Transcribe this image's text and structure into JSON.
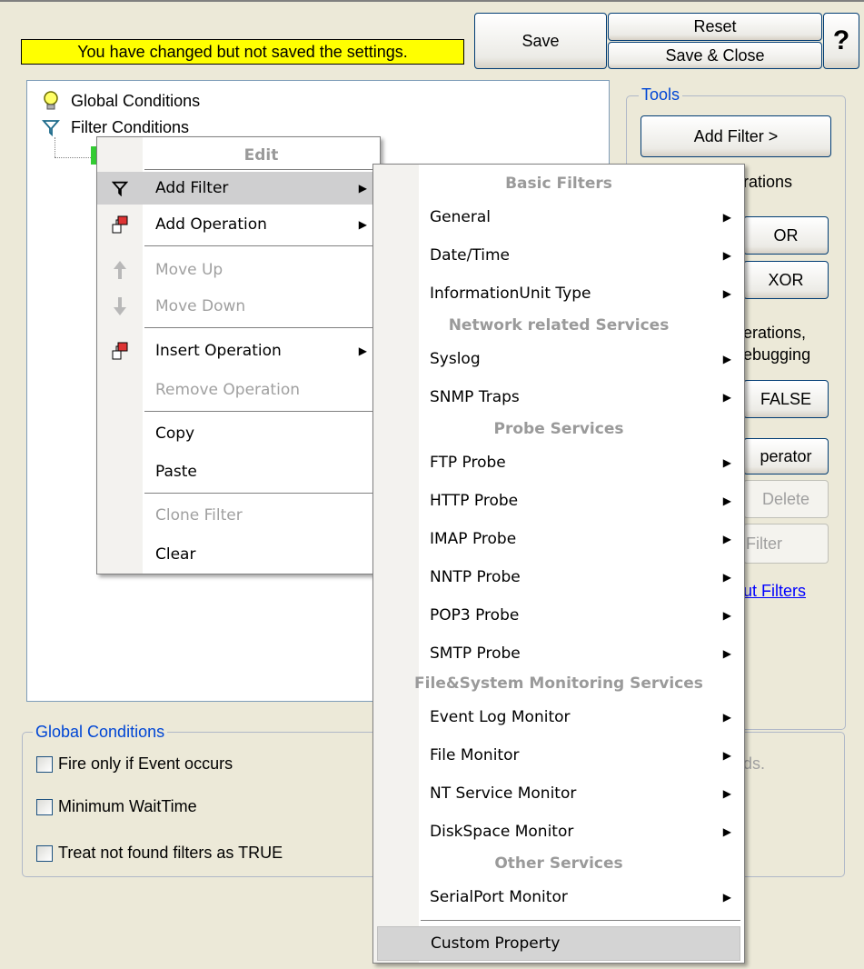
{
  "warning": "You have changed but not saved the settings.",
  "buttons": {
    "save": "Save",
    "reset": "Reset",
    "save_close": "Save & Close",
    "help": "?"
  },
  "tree": {
    "global_conditions": "Global Conditions",
    "filter_conditions": "Filter Conditions"
  },
  "tools": {
    "label": "Tools",
    "add_filter": "Add Filter >",
    "operations_text": "rations",
    "or": "OR",
    "xor": "XOR",
    "operations_text2": "erations,",
    "debugging_text": "ebugging",
    "false": "FALSE",
    "operator": "perator",
    "delete": "Delete",
    "filter": "Filter",
    "filters_link": "ut Filters",
    "seconds_text": "ds."
  },
  "global_conditions": {
    "label": "Global Conditions",
    "fire_only": "Fire only if Event occurs",
    "min_wait": "Minimum WaitTime",
    "treat_not_found": "Treat not found filters as TRUE"
  },
  "edit_menu": {
    "header": "Edit",
    "items": [
      {
        "label": "Add Filter",
        "icon": "filter-icon"
      },
      {
        "label": "Add Operation",
        "icon": "operation-icon"
      },
      {
        "label": "Move Up",
        "icon": "up-arrow-icon"
      },
      {
        "label": "Move Down",
        "icon": "down-arrow-icon"
      },
      {
        "label": "Insert Operation",
        "icon": "operation-icon"
      },
      {
        "label": "Remove Operation"
      },
      {
        "label": "Copy"
      },
      {
        "label": "Paste"
      },
      {
        "label": "Clone Filter"
      },
      {
        "label": "Clear"
      }
    ]
  },
  "filter_menu": {
    "basic_header": "Basic Filters",
    "general": "General",
    "datetime": "Date/Time",
    "infounit": "InformationUnit Type",
    "network_header": "Network related Services",
    "syslog": "Syslog",
    "snmp": "SNMP Traps",
    "probe_header": "Probe Services",
    "ftp": "FTP Probe",
    "http": "HTTP Probe",
    "imap": "IMAP Probe",
    "nntp": "NNTP Probe",
    "pop3": "POP3 Probe",
    "smtp": "SMTP Probe",
    "filesys_header": "File&System Monitoring Services",
    "eventlog": "Event Log Monitor",
    "filemon": "File Monitor",
    "ntservice": "NT Service Monitor",
    "diskspace": "DiskSpace Monitor",
    "other_header": "Other Services",
    "serialport": "SerialPort Monitor",
    "custom": "Custom Property"
  }
}
